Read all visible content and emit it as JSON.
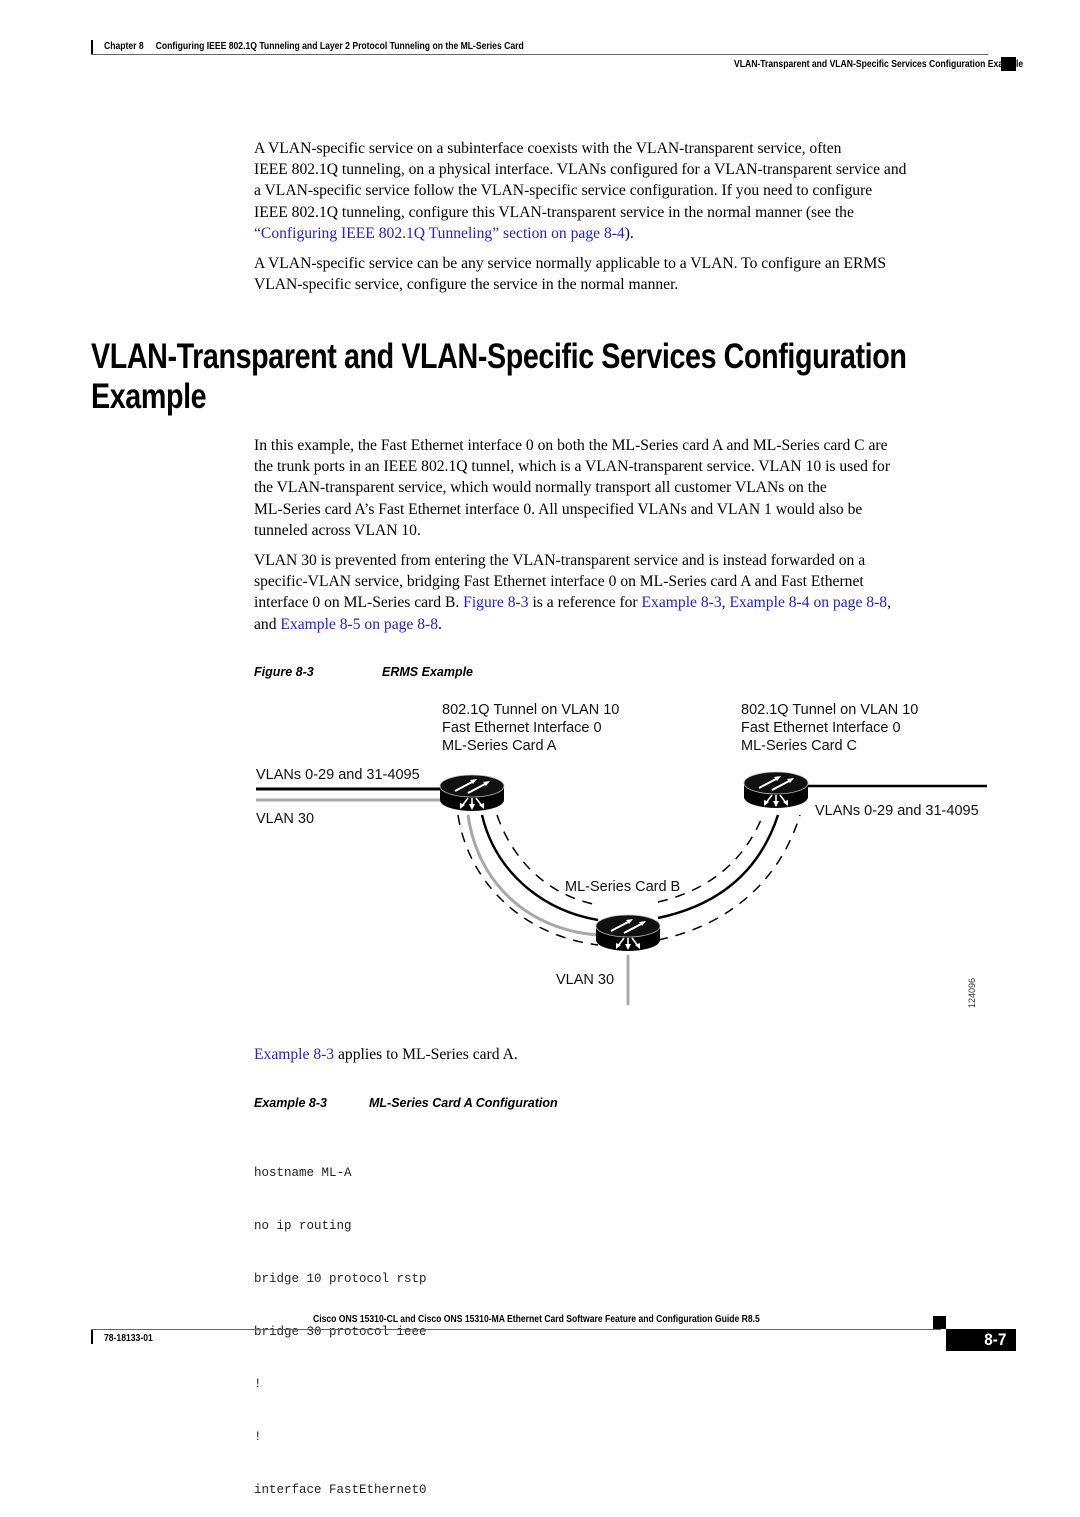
{
  "header": {
    "chapter": "Chapter 8",
    "chapter_title": "Configuring IEEE 802.1Q Tunneling and Layer 2 Protocol Tunneling on the ML-Series Card",
    "section_title": "VLAN-Transparent and VLAN-Specific Services Configuration Example"
  },
  "intro": {
    "p1_lines": [
      "A VLAN-specific service on a subinterface coexists with the VLAN-transparent service, often",
      "IEEE 802.1Q tunneling, on a physical interface. VLANs configured for a VLAN-transparent service and",
      "a VLAN-specific service follow the VLAN-specific service configuration. If you need to configure",
      "IEEE 802.1Q tunneling, configure this VLAN-transparent service in the normal manner (see the"
    ],
    "p1_link": "“Configuring IEEE 802.1Q Tunneling” section on page 8-4",
    "p1_end": ").",
    "p2_lines": [
      "A VLAN-specific service can be any service normally applicable to a VLAN. To configure an ERMS",
      "VLAN-specific service, configure the service in the normal manner."
    ]
  },
  "section": {
    "heading_line1": "VLAN-Transparent and VLAN-Specific Services Configuration",
    "heading_line2": "Example",
    "p3_lines": [
      "In this example, the Fast Ethernet interface 0 on both the ML-Series card A and ML-Series card C are",
      "the trunk ports in an IEEE 802.1Q tunnel, which is a VLAN-transparent service. VLAN 10 is used for",
      "the VLAN-transparent service, which would normally transport all customer VLANs on the",
      "ML-Series card A’s Fast Ethernet interface 0. All unspecified VLANs and VLAN 1 would also be",
      "tunneled across VLAN 10."
    ],
    "p4": {
      "line1": "VLAN 30 is prevented from entering the VLAN-transparent service and is instead forwarded on a",
      "line2": "specific-VLAN service, bridging Fast Ethernet interface 0 on ML-Series card A and Fast Ethernet",
      "line3_a": "interface 0 on ML-Series card B. ",
      "link_figure": "Figure 8-3",
      "line3_b": " is a reference for ",
      "link_ex3": "Example 8-3",
      "sep1": ", ",
      "link_ex4": "Example 8-4 on page 8-8",
      "sep2": ",",
      "line4_a": "and ",
      "link_ex5": "Example 8-5 on page 8-8",
      "line4_end": "."
    }
  },
  "figure": {
    "number": "Figure 8-3",
    "title": "ERMS Example",
    "card_a_label": [
      "802.1Q Tunnel on VLAN 10",
      "Fast Ethernet Interface 0",
      "ML-Series Card A"
    ],
    "card_c_label": [
      "802.1Q Tunnel on VLAN 10",
      "Fast Ethernet Interface 0",
      "ML-Series Card C"
    ],
    "left_vlans": "VLANs 0-29 and 31-4095",
    "left_vlan30": "VLAN 30",
    "right_vlans": "VLANs 0-29 and 31-4095",
    "card_b_label": "ML-Series Card B",
    "bottom_vlan30": "VLAN 30",
    "figure_id": "124096",
    "icons": [
      "router-icon",
      "router-icon",
      "router-icon"
    ]
  },
  "after_figure": {
    "link": "Example 8-3",
    "text": " applies to ML-Series card A."
  },
  "example": {
    "number": "Example 8-3",
    "title": "ML-Series Card A Configuration",
    "code_lines": [
      "hostname ML-A",
      "no ip routing",
      "bridge 10 protocol rstp",
      "bridge 30 protocol ieee",
      "!",
      "!",
      "interface FastEthernet0"
    ]
  },
  "footer": {
    "guide_title": "Cisco ONS 15310-CL and Cisco ONS 15310-MA Ethernet Card Software Feature and Configuration Guide R8.5",
    "doc_number": "78-18133-01",
    "page_number": "8-7"
  }
}
